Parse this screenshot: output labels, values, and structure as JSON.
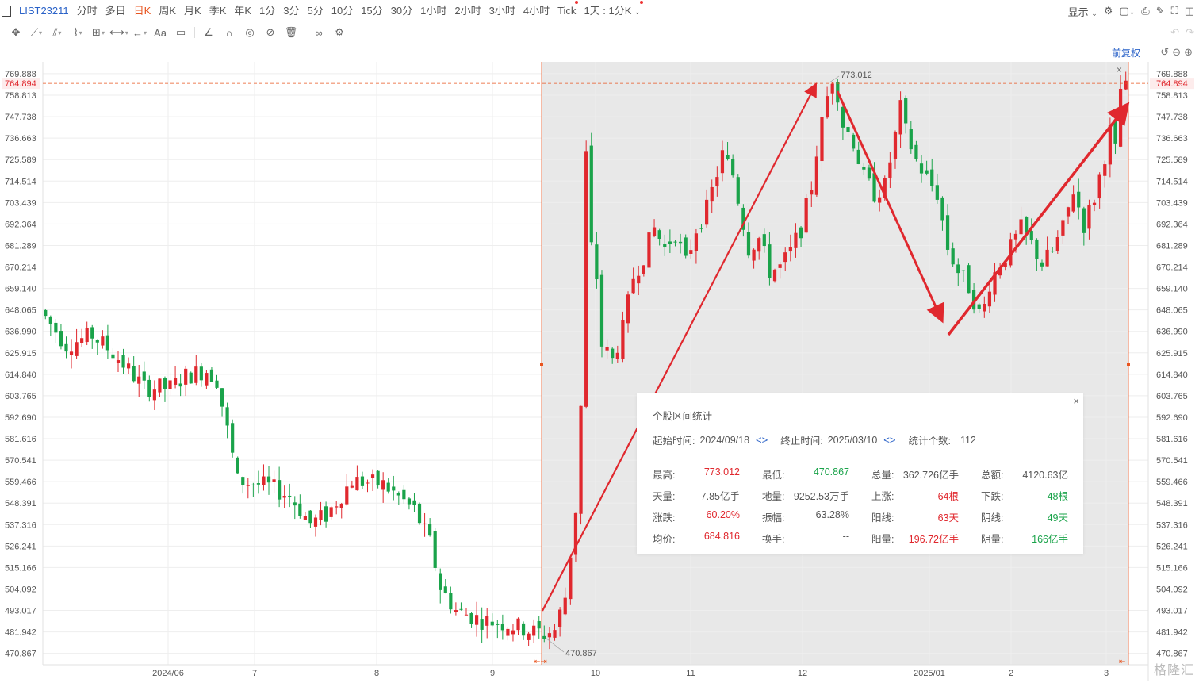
{
  "toolbar": {
    "symbol": "LIST23211",
    "periods": [
      "分时",
      "多日",
      "日K",
      "周K",
      "月K",
      "季K",
      "年K",
      "1分",
      "3分",
      "5分",
      "10分",
      "15分",
      "30分",
      "1小时",
      "2小时",
      "3小时",
      "4小时",
      "Tick",
      "1天 : 1分K"
    ],
    "active_period": "日K",
    "display_label": "显示",
    "tools": [
      "move-icon",
      "line-icon",
      "channel-icon",
      "wave-icon",
      "fib-icon",
      "measure-icon",
      "arrow-icon",
      "text-icon",
      "comment-icon",
      "angle-icon",
      "magnet-icon",
      "eye-icon",
      "hide-icon",
      "trash-icon",
      "link-icon",
      "settings-icon"
    ]
  },
  "adjust_label": "前复权",
  "axis": {
    "y_ticks": [
      "769.888",
      "758.813",
      "747.738",
      "736.663",
      "725.589",
      "714.514",
      "703.439",
      "692.364",
      "681.289",
      "670.214",
      "659.140",
      "648.065",
      "636.990",
      "625.915",
      "614.840",
      "603.765",
      "592.690",
      "581.616",
      "570.541",
      "559.466",
      "548.391",
      "537.316",
      "526.241",
      "515.166",
      "504.092",
      "493.017",
      "481.942",
      "470.867"
    ],
    "x_labels": [
      "2024/06",
      "7",
      "8",
      "9",
      "10",
      "11",
      "12",
      "2025/01",
      "2",
      "3"
    ],
    "current_price": "764.894"
  },
  "annotations": {
    "high": "773.012",
    "low": "470.867"
  },
  "stats": {
    "title": "个股区间统计",
    "start_label": "起始时间:",
    "start_value": "2024/09/18",
    "end_label": "终止时间:",
    "end_value": "2025/03/10",
    "count_label": "统计个数:",
    "count_value": "112",
    "rows": [
      [
        [
          "最高:",
          "773.012",
          "red"
        ],
        [
          "最低:",
          "470.867",
          "green"
        ],
        [
          "总量:",
          "362.726亿手",
          "dark"
        ],
        [
          "总额:",
          "4120.63亿",
          "dark"
        ]
      ],
      [
        [
          "天量:",
          "7.85亿手",
          "dark"
        ],
        [
          "地量:",
          "9252.53万手",
          "dark"
        ],
        [
          "上涨:",
          "64根",
          "red"
        ],
        [
          "下跌:",
          "48根",
          "green"
        ]
      ],
      [
        [
          "涨跌:",
          "60.20%",
          "red"
        ],
        [
          "振幅:",
          "63.28%",
          "dark"
        ],
        [
          "阳线:",
          "63天",
          "red"
        ],
        [
          "阴线:",
          "49天",
          "green"
        ]
      ],
      [
        [
          "均价:",
          "684.816",
          "red"
        ],
        [
          "换手:",
          "--",
          "dark"
        ],
        [
          "阳量:",
          "196.72亿手",
          "red"
        ],
        [
          "阴量:",
          "166亿手",
          "green"
        ]
      ]
    ]
  },
  "watermark": "格隆汇",
  "colors": {
    "up": "#e0282e",
    "down": "#1aa34a",
    "accent": "#e8541f",
    "blue": "#2a62c8"
  },
  "chart_data": {
    "type": "candlestick",
    "ylim": [
      465,
      776
    ],
    "segments": [
      {
        "name": "pre",
        "count": 96,
        "points": [
          [
            0,
            648
          ],
          [
            5,
            630
          ],
          [
            10,
            635
          ],
          [
            14,
            626
          ],
          [
            20,
            608
          ],
          [
            25,
            608
          ],
          [
            28,
            614
          ],
          [
            32,
            617
          ],
          [
            34,
            612
          ],
          [
            38,
            560
          ],
          [
            44,
            557
          ],
          [
            48,
            552
          ],
          [
            52,
            538
          ],
          [
            55,
            542
          ],
          [
            60,
            560
          ],
          [
            66,
            558
          ],
          [
            72,
            545
          ],
          [
            75,
            528
          ],
          [
            77,
            505
          ],
          [
            80,
            493
          ],
          [
            85,
            488
          ],
          [
            90,
            486
          ],
          [
            95,
            482
          ]
        ]
      },
      {
        "name": "range",
        "count": 112,
        "points": [
          [
            0,
            480
          ],
          [
            3,
            483
          ],
          [
            5,
            500
          ],
          [
            7,
            545
          ],
          [
            8,
            598
          ],
          [
            9,
            728
          ],
          [
            10,
            680
          ],
          [
            11,
            665
          ],
          [
            12,
            630
          ],
          [
            14,
            622
          ],
          [
            16,
            638
          ],
          [
            18,
            665
          ],
          [
            20,
            676
          ],
          [
            22,
            690
          ],
          [
            24,
            680
          ],
          [
            26,
            688
          ],
          [
            28,
            672
          ],
          [
            30,
            690
          ],
          [
            32,
            700
          ],
          [
            35,
            728
          ],
          [
            37,
            718
          ],
          [
            40,
            680
          ],
          [
            42,
            685
          ],
          [
            44,
            668
          ],
          [
            46,
            670
          ],
          [
            48,
            678
          ],
          [
            50,
            690
          ],
          [
            52,
            712
          ],
          [
            53,
            730
          ],
          [
            55,
            758
          ],
          [
            56,
            768
          ],
          [
            57,
            760
          ],
          [
            58,
            744
          ],
          [
            60,
            735
          ],
          [
            62,
            716
          ],
          [
            64,
            708
          ],
          [
            66,
            712
          ],
          [
            68,
            738
          ],
          [
            69,
            752
          ],
          [
            70,
            740
          ],
          [
            72,
            725
          ],
          [
            74,
            716
          ],
          [
            76,
            708
          ],
          [
            78,
            680
          ],
          [
            80,
            668
          ],
          [
            82,
            660
          ],
          [
            84,
            646
          ],
          [
            85,
            650
          ],
          [
            86,
            662
          ],
          [
            88,
            672
          ],
          [
            90,
            680
          ],
          [
            92,
            690
          ],
          [
            94,
            682
          ],
          [
            96,
            672
          ],
          [
            98,
            678
          ],
          [
            100,
            690
          ],
          [
            102,
            710
          ],
          [
            104,
            692
          ],
          [
            106,
            706
          ],
          [
            108,
            728
          ],
          [
            109,
            740
          ],
          [
            110,
            730
          ],
          [
            111,
            762
          ]
        ]
      }
    ]
  }
}
